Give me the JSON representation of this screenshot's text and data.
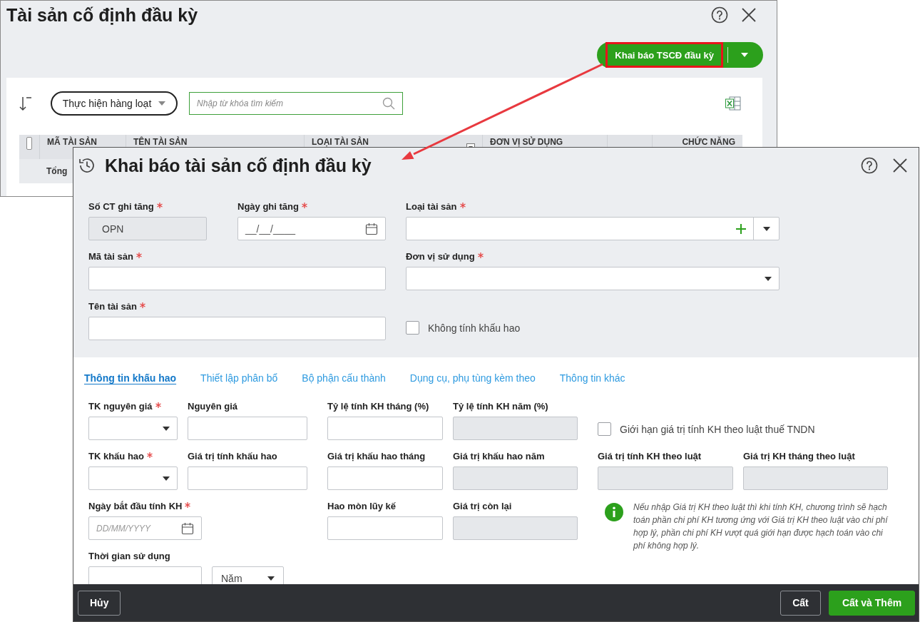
{
  "background_window": {
    "title": "Tài sản cố định đầu kỳ",
    "primary_button": {
      "label": "Khai báo TSCĐ đầu kỳ",
      "highlighted": true
    },
    "bulk_button": {
      "label": "Thực hiện hàng loạt"
    },
    "search": {
      "placeholder": "Nhập từ khóa tìm kiếm"
    },
    "table": {
      "select_all": {
        "checked": false
      },
      "columns": [
        {
          "label": "MÃ TÀI SẢN",
          "filter": false
        },
        {
          "label": "TÊN TÀI SẢN",
          "filter": false
        },
        {
          "label": "LOẠI TÀI SẢN",
          "filter": true
        },
        {
          "label": "ĐƠN VỊ SỬ DỤNG",
          "filter": false
        },
        {
          "label": "CHỨC NĂNG",
          "filter": false
        }
      ],
      "total_label": "Tổng"
    }
  },
  "dialog": {
    "title": "Khai báo tài sản cố định đầu kỳ",
    "general_fields": [
      {
        "label": "Số CT ghi tăng",
        "required": true,
        "kind": "text",
        "value": "OPN",
        "disabled": true
      },
      {
        "label": "Ngày ghi tăng",
        "required": true,
        "kind": "date",
        "placeholder": "__/__/____",
        "disabled": false
      },
      {
        "label": "Loại tài sản",
        "required": true,
        "kind": "add_select",
        "disabled": false
      },
      {
        "label": "Mã tài sản",
        "required": true,
        "kind": "text",
        "disabled": false
      },
      {
        "label": "Đơn vị sử dụng",
        "required": true,
        "kind": "select",
        "disabled": false
      },
      {
        "label": "Tên tài sản",
        "required": true,
        "kind": "text",
        "disabled": false
      }
    ],
    "no_depreciation": {
      "label": "Không tính khấu hao",
      "checked": false
    },
    "tabs": [
      {
        "label": "Thông tin khấu hao",
        "selected": true
      },
      {
        "label": "Thiết lập phân bổ",
        "selected": false
      },
      {
        "label": "Bộ phận cấu thành",
        "selected": false
      },
      {
        "label": "Dụng cụ, phụ tùng kèm theo",
        "selected": false
      },
      {
        "label": "Thông tin khác",
        "selected": false
      }
    ],
    "depreciation_fields": [
      {
        "label": "TK nguyên giá",
        "required": true,
        "kind": "select",
        "disabled": false
      },
      {
        "label": "Nguyên giá",
        "required": false,
        "kind": "text",
        "disabled": false
      },
      {
        "label": "Tỷ lệ tính KH tháng (%)",
        "required": false,
        "kind": "text",
        "disabled": false
      },
      {
        "label": "Tỷ lệ tính KH năm (%)",
        "required": false,
        "kind": "text",
        "disabled": true
      },
      {
        "label": "TK khấu hao",
        "required": true,
        "kind": "select",
        "disabled": false
      },
      {
        "label": "Giá trị tính khấu hao",
        "required": false,
        "kind": "text",
        "disabled": false
      },
      {
        "label": "Giá trị khấu hao tháng",
        "required": false,
        "kind": "text",
        "disabled": false
      },
      {
        "label": "Giá trị khấu hao năm",
        "required": false,
        "kind": "text",
        "disabled": true
      },
      {
        "label": "Giá trị tính KH theo luật",
        "required": false,
        "kind": "text",
        "disabled": true
      },
      {
        "label": "Giá trị KH tháng theo luật",
        "required": false,
        "kind": "text",
        "disabled": true
      },
      {
        "label": "Ngày bắt đầu tính KH",
        "required": true,
        "kind": "date",
        "placeholder": "DD/MM/YYYY",
        "disabled": false
      },
      {
        "label": "Hao mòn lũy kế",
        "required": false,
        "kind": "text",
        "disabled": false
      },
      {
        "label": "Giá trị còn lại",
        "required": false,
        "kind": "text",
        "disabled": true
      },
      {
        "label": "Thời gian sử dụng",
        "required": false,
        "kind": "duration",
        "unit": "Năm",
        "disabled": false
      }
    ],
    "tax_limit": {
      "label": "Giới hạn giá trị tính KH theo luật thuế TNDN",
      "checked": false
    },
    "note": "Nếu nhập Giá trị KH theo luật thì khi tính KH, chương trình sẽ hạch toán phần chi phí KH tương ứng với Giá trị KH theo luật vào chi phí hợp lý, phần chi phí KH vượt quá giới hạn được hạch toán vào chi phí không hợp lý.",
    "buttons": [
      {
        "label": "Hủy",
        "kind": "secondary"
      },
      {
        "label": "Cất",
        "kind": "secondary"
      },
      {
        "label": "Cất và Thêm",
        "kind": "primary"
      }
    ]
  }
}
